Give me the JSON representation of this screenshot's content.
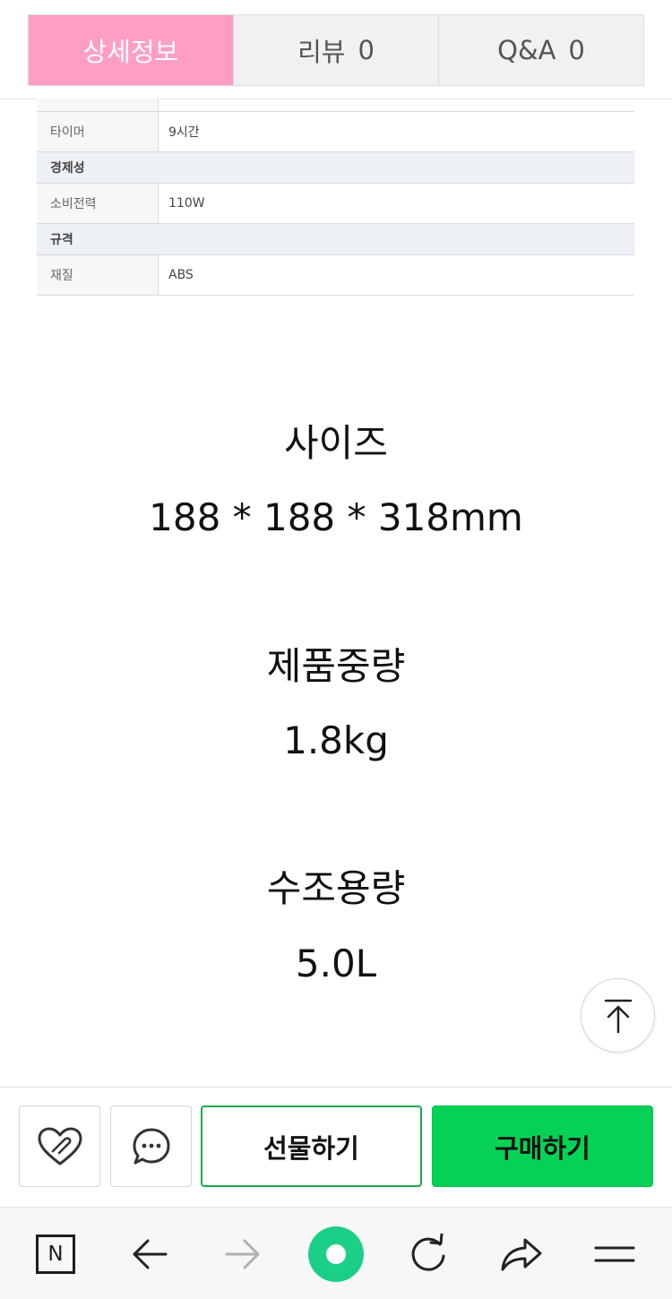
{
  "tabs": [
    {
      "label": "상세정보",
      "count": ""
    },
    {
      "label": "리뷰",
      "count": "0"
    },
    {
      "label": "Q&A",
      "count": "0"
    }
  ],
  "spec": {
    "rows": [
      {
        "type": "row",
        "key": "타이머",
        "value": "9시간"
      },
      {
        "type": "section",
        "title": "경제성"
      },
      {
        "type": "row",
        "key": "소비전력",
        "value": "110W"
      },
      {
        "type": "section",
        "title": "규격"
      },
      {
        "type": "row",
        "key": "재질",
        "value": "ABS"
      }
    ]
  },
  "details": {
    "size_title": "사이즈",
    "size_value": "188 * 188 * 318mm",
    "weight_title": "제품중량",
    "weight_value": "1.8kg",
    "capacity_title": "수조용량",
    "capacity_value": "5.0L"
  },
  "buybar": {
    "gift_label": "선물하기",
    "buy_label": "구매하기"
  },
  "nav": {
    "n_label": "N"
  },
  "colors": {
    "active_tab": "#ff9ec4",
    "buy_green": "#05d255",
    "gift_border": "#1aa84c",
    "home_green": "#1bcf87"
  },
  "icons": {
    "like": "heart-icon",
    "chat": "chat-bubble-icon",
    "scroll_top": "arrow-up-to-line-icon",
    "back": "arrow-left-icon",
    "forward": "arrow-right-icon",
    "home": "home-circle-icon",
    "refresh": "refresh-icon",
    "share": "share-arrow-icon",
    "menu": "menu-icon"
  }
}
